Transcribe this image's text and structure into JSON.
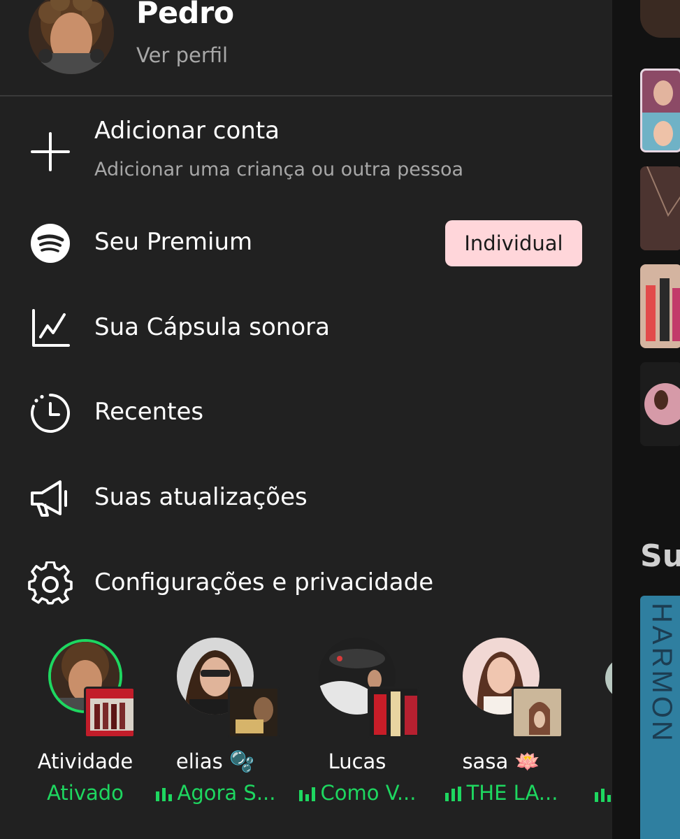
{
  "profile": {
    "name": "Pedro",
    "link": "Ver perfil"
  },
  "menu": {
    "add_account": {
      "label": "Adicionar conta",
      "sublabel": "Adicionar uma criança ou outra pessoa",
      "icon": "plus-icon"
    },
    "premium": {
      "label": "Seu Premium",
      "badge": "Individual",
      "icon": "spotify-logo-icon"
    },
    "capsule": {
      "label": "Sua Cápsula sonora",
      "icon": "chart-line-icon"
    },
    "recent": {
      "label": "Recentes",
      "icon": "clock-history-icon"
    },
    "updates": {
      "label": "Suas atualizações",
      "icon": "megaphone-icon"
    },
    "settings": {
      "label": "Configurações e privacidade",
      "icon": "gear-icon"
    }
  },
  "friends": [
    {
      "name": "Atividade",
      "status": "Ativado",
      "playing": false
    },
    {
      "name": "elias",
      "emoji": "🫧",
      "status": "Agora S...",
      "playing": true
    },
    {
      "name": "Lucas",
      "status": "Como V...",
      "playing": true
    },
    {
      "name": "sasa",
      "emoji": "🪷",
      "status": "THE LA...",
      "playing": true
    }
  ],
  "background": {
    "heading": "Su",
    "cover_text": "FIFTH HARMON"
  },
  "colors": {
    "drawer": "#212121",
    "accent_green": "#1ed760",
    "badge_bg": "#ffd6da",
    "secondary_text": "#a7a7a7"
  }
}
